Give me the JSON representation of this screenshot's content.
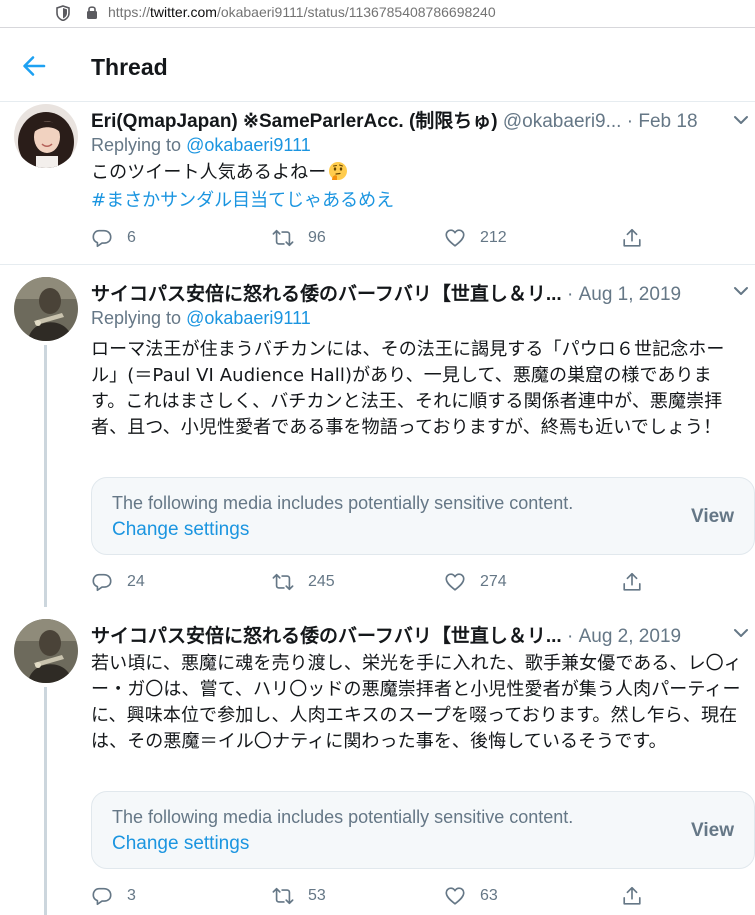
{
  "browser": {
    "url_prefix": "https://",
    "url_host": "twitter.com",
    "url_path": "/okabaeri9111/status/1136785408786698240"
  },
  "header": {
    "title": "Thread"
  },
  "tweets": [
    {
      "name": "Eri(QmapJapan) ※SameParlerAcc. (制限ちゅ)",
      "handle": "@okabaeri9...",
      "dot": "·",
      "date": "Feb 18",
      "replying_label": "Replying to",
      "replying_to": "@okabaeri9111",
      "text": "このツイート人気あるよねー",
      "emoji": "thinking-face-emoji",
      "hashtag": "#まさかサンダル目当てじゃあるめえ",
      "replies": "6",
      "retweets": "96",
      "likes": "212"
    },
    {
      "name": "サイコパス安倍に怒れる倭のバーフバリ【世直し＆リ...",
      "handle": "",
      "dot": "·",
      "date": "Aug 1, 2019",
      "replying_label": "Replying to",
      "replying_to": "@okabaeri9111",
      "text": "ローマ法王が住まうバチカンには、その法王に謁見する「パウロ６世記念ホール」(＝Paul VI Audience Hall)があり、一見して、悪魔の巣窟の様であります。これはまさしく、バチカンと法王、それに順する関係者連中が、悪魔崇拝者、且つ、小児性愛者である事を物語っておりますが、終焉も近いでしょう！",
      "sensitive_msg": "The following media includes potentially sensitive content.",
      "change_settings": "Change settings",
      "view": "View",
      "replies": "24",
      "retweets": "245",
      "likes": "274"
    },
    {
      "name": "サイコパス安倍に怒れる倭のバーフバリ【世直し＆リ...",
      "handle": "",
      "dot": "·",
      "date": "Aug 2, 2019",
      "text": "若い頃に、悪魔に魂を売り渡し、栄光を手に入れた、歌手兼女優である、レ〇ィー・ガ〇は、嘗て、ハリ〇ッドの悪魔崇拝者と小児性愛者が集う人肉パーティーに、興味本位で参加し、人肉エキスのスープを啜っております。然し乍ら、現在は、その悪魔＝イル〇ナティに関わった事を、後悔しているそうです。",
      "sensitive_msg": "The following media includes potentially sensitive content.",
      "change_settings": "Change settings",
      "view": "View",
      "replies": "3",
      "retweets": "53",
      "likes": "63"
    }
  ],
  "colors": {
    "link": "#1b95e0",
    "muted": "#657786",
    "text": "#14171a",
    "thread_line": "#ccd6dd",
    "card_bg": "#f5f8fa"
  }
}
